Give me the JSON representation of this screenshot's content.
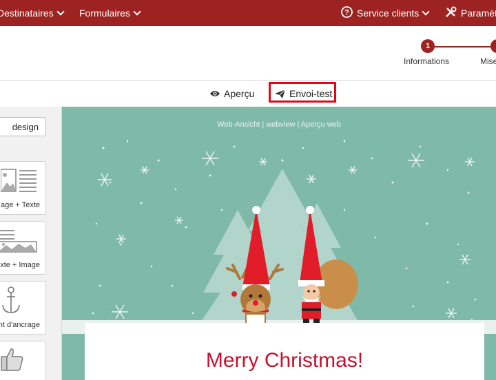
{
  "nav": {
    "recipients": "Destinataires",
    "forms": "Formulaires",
    "support": "Service clients",
    "settings": "Paramèt"
  },
  "stepper": {
    "step1_number": "1",
    "step1_label": "Informations",
    "step2_label": "Mise"
  },
  "toolbar": {
    "preview": "Aperçu",
    "test_send": "Envoi-test"
  },
  "leftpanel": {
    "design_button": "design",
    "blocks": [
      {
        "label": "age + Texte"
      },
      {
        "label": "xte + Image"
      },
      {
        "label": "nt d'ancrage"
      },
      {
        "label": ""
      }
    ]
  },
  "email": {
    "web_links": "Web-Ansicht | webview | Aperçu web",
    "headline": "Merry Christmas!"
  },
  "colors": {
    "brand_red": "#9d2222",
    "highlight": "#e30613",
    "email_bg": "#7fbaa9"
  }
}
